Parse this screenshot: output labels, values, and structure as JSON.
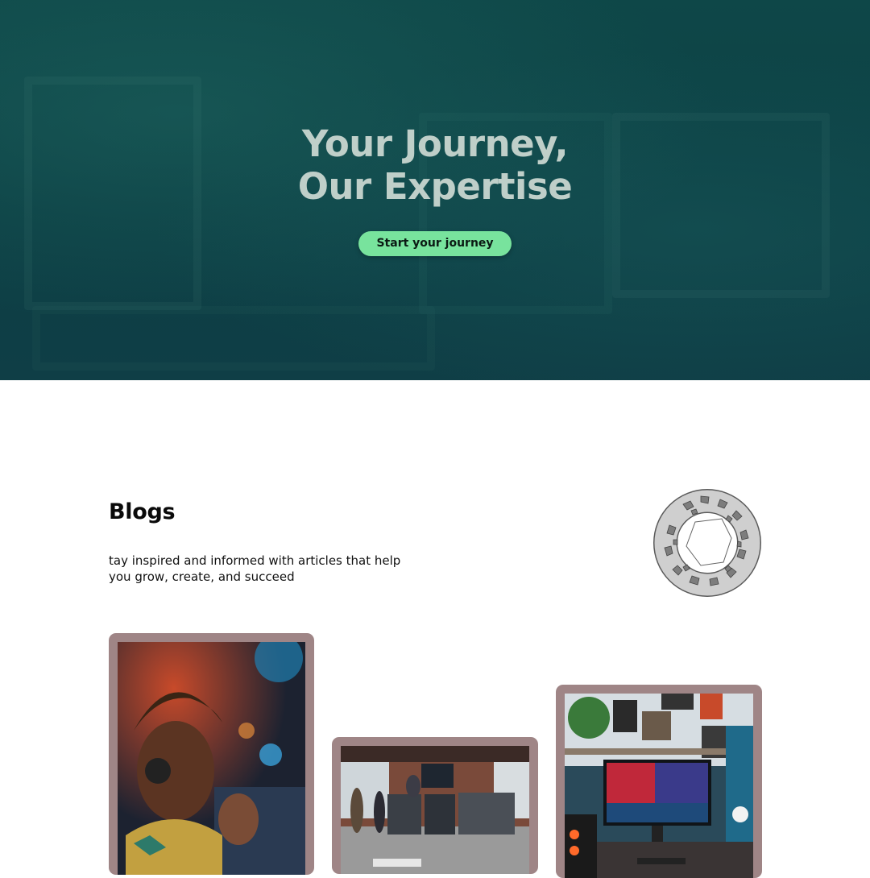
{
  "hero": {
    "title_line1": "Your Journey,",
    "title_line2": "Our Expertise",
    "cta_label": "Start your journey",
    "background_color": "#0e4748",
    "cta_color": "#78e39d"
  },
  "blogs": {
    "title": "Blogs",
    "description": "tay inspired and informed with articles that help you grow, create, and succeed",
    "decoration_icon": "mosaic-ring-icon",
    "card_frame_color": "#9f8586",
    "cards": [
      {
        "image": "person-with-headphones-photo"
      },
      {
        "image": "office-workstations-photo"
      },
      {
        "image": "desk-monitor-setup-photo"
      }
    ]
  }
}
